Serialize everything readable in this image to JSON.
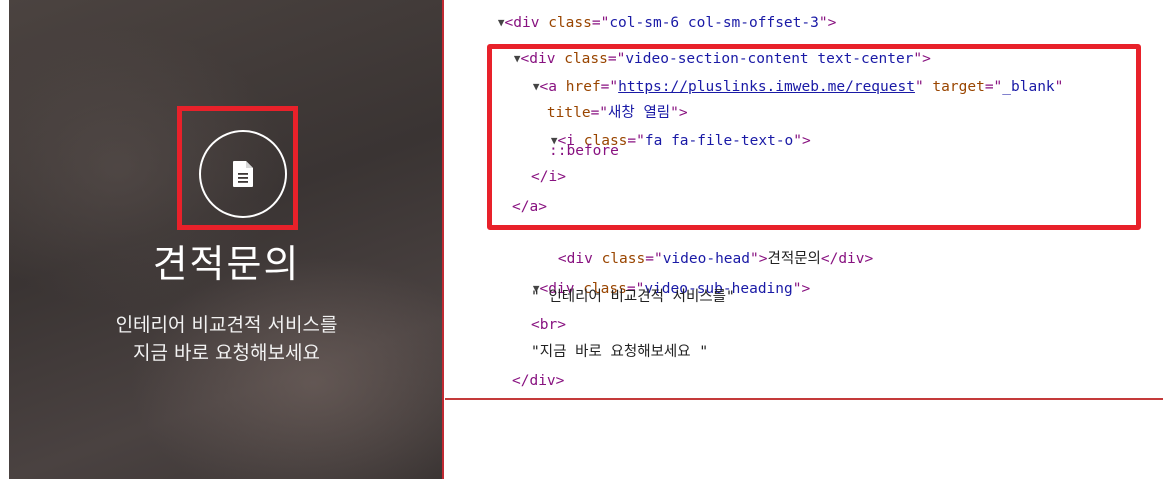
{
  "preview": {
    "heading": "견적문의",
    "sub_line1": "인테리어 비교견적 서비스를",
    "sub_line2": "지금 바로 요청해보세요",
    "icon": "file-text-icon"
  },
  "devtools": {
    "lines": {
      "l0": {
        "open": "<div ",
        "attr": "class",
        "eq": "=\"",
        "val": "col-sm-6 col-sm-offset-3",
        "close": "\">"
      },
      "l1": {
        "open": "<div ",
        "attr": "class",
        "eq": "=\"",
        "val": "video-section-content text-center",
        "close": "\">"
      },
      "l2": {
        "open": "<a ",
        "attr1": "href",
        "eq1": "=\"",
        "href": "https://pluslinks.imweb.me/request",
        "q1": "\" ",
        "attr2": "target",
        "eq2": "=\"",
        "val2": "_blank",
        "q2": "\""
      },
      "l3": {
        "attr": "title",
        "eq": "=\"",
        "val": "새창 열림",
        "close": "\">"
      },
      "l4": {
        "open": "<i ",
        "attr": "class",
        "eq": "=\"",
        "val": "fa fa-file-text-o",
        "close": "\">"
      },
      "l5": {
        "text": "::before"
      },
      "l6": {
        "text": "</i>"
      },
      "l7": {
        "text": "</a>"
      },
      "l8": {
        "open": "<div ",
        "attr": "class",
        "eq": "=\"",
        "val": "video-head",
        "close": "\">",
        "inner": "견적문의",
        "end": "</div>"
      },
      "l9": {
        "open": "<div ",
        "attr": "class",
        "eq": "=\"",
        "val": "video-sub-heading",
        "close": "\">"
      },
      "l10": {
        "text": "\" 인테리어 비교견적 서비스를\""
      },
      "l11": {
        "text": "<br>"
      },
      "l12": {
        "text": "\"지금 바로 요청해보세요 \""
      },
      "l13": {
        "text": "</div>"
      }
    },
    "arrow": "▼"
  },
  "colors": {
    "highlight": "#e8212a",
    "tag": "#881280",
    "attr": "#994500",
    "value": "#1a1aa6"
  }
}
